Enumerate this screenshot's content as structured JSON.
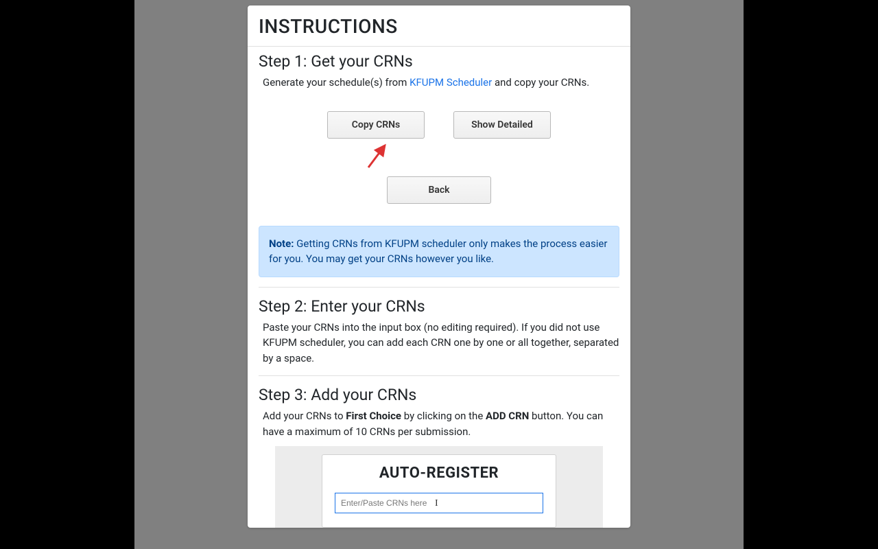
{
  "header": {
    "title": "INSTRUCTIONS"
  },
  "step1": {
    "heading": "Step 1: Get your CRNs",
    "intro_pre": "Generate your schedule(s) from ",
    "scheduler_link_text": "KFUPM Scheduler",
    "intro_post": " and copy your CRNs.",
    "copy_btn": "Copy CRNs",
    "show_detailed_btn": "Show Detailed",
    "back_btn": "Back"
  },
  "note": {
    "label": "Note:",
    "text": " Getting CRNs from KFUPM scheduler only makes the process easier for you. You may get your CRNs however you like."
  },
  "step2": {
    "heading": "Step 2: Enter your CRNs",
    "body": "Paste your CRNs into the input box (no editing required). If you did not use KFUPM scheduler, you can add each CRN one by one or all together, separated by a space."
  },
  "step3": {
    "heading": "Step 3: Add your CRNs",
    "body_pre": "Add your CRNs to ",
    "first_choice": "First Choice",
    "body_mid": " by clicking on the ",
    "add_crn": "ADD CRN",
    "body_post": " button. You can have a maximum of 10 CRNs per submission.",
    "inner_title": "AUTO-REGISTER",
    "inner_placeholder": "Enter/Paste CRNs here"
  }
}
